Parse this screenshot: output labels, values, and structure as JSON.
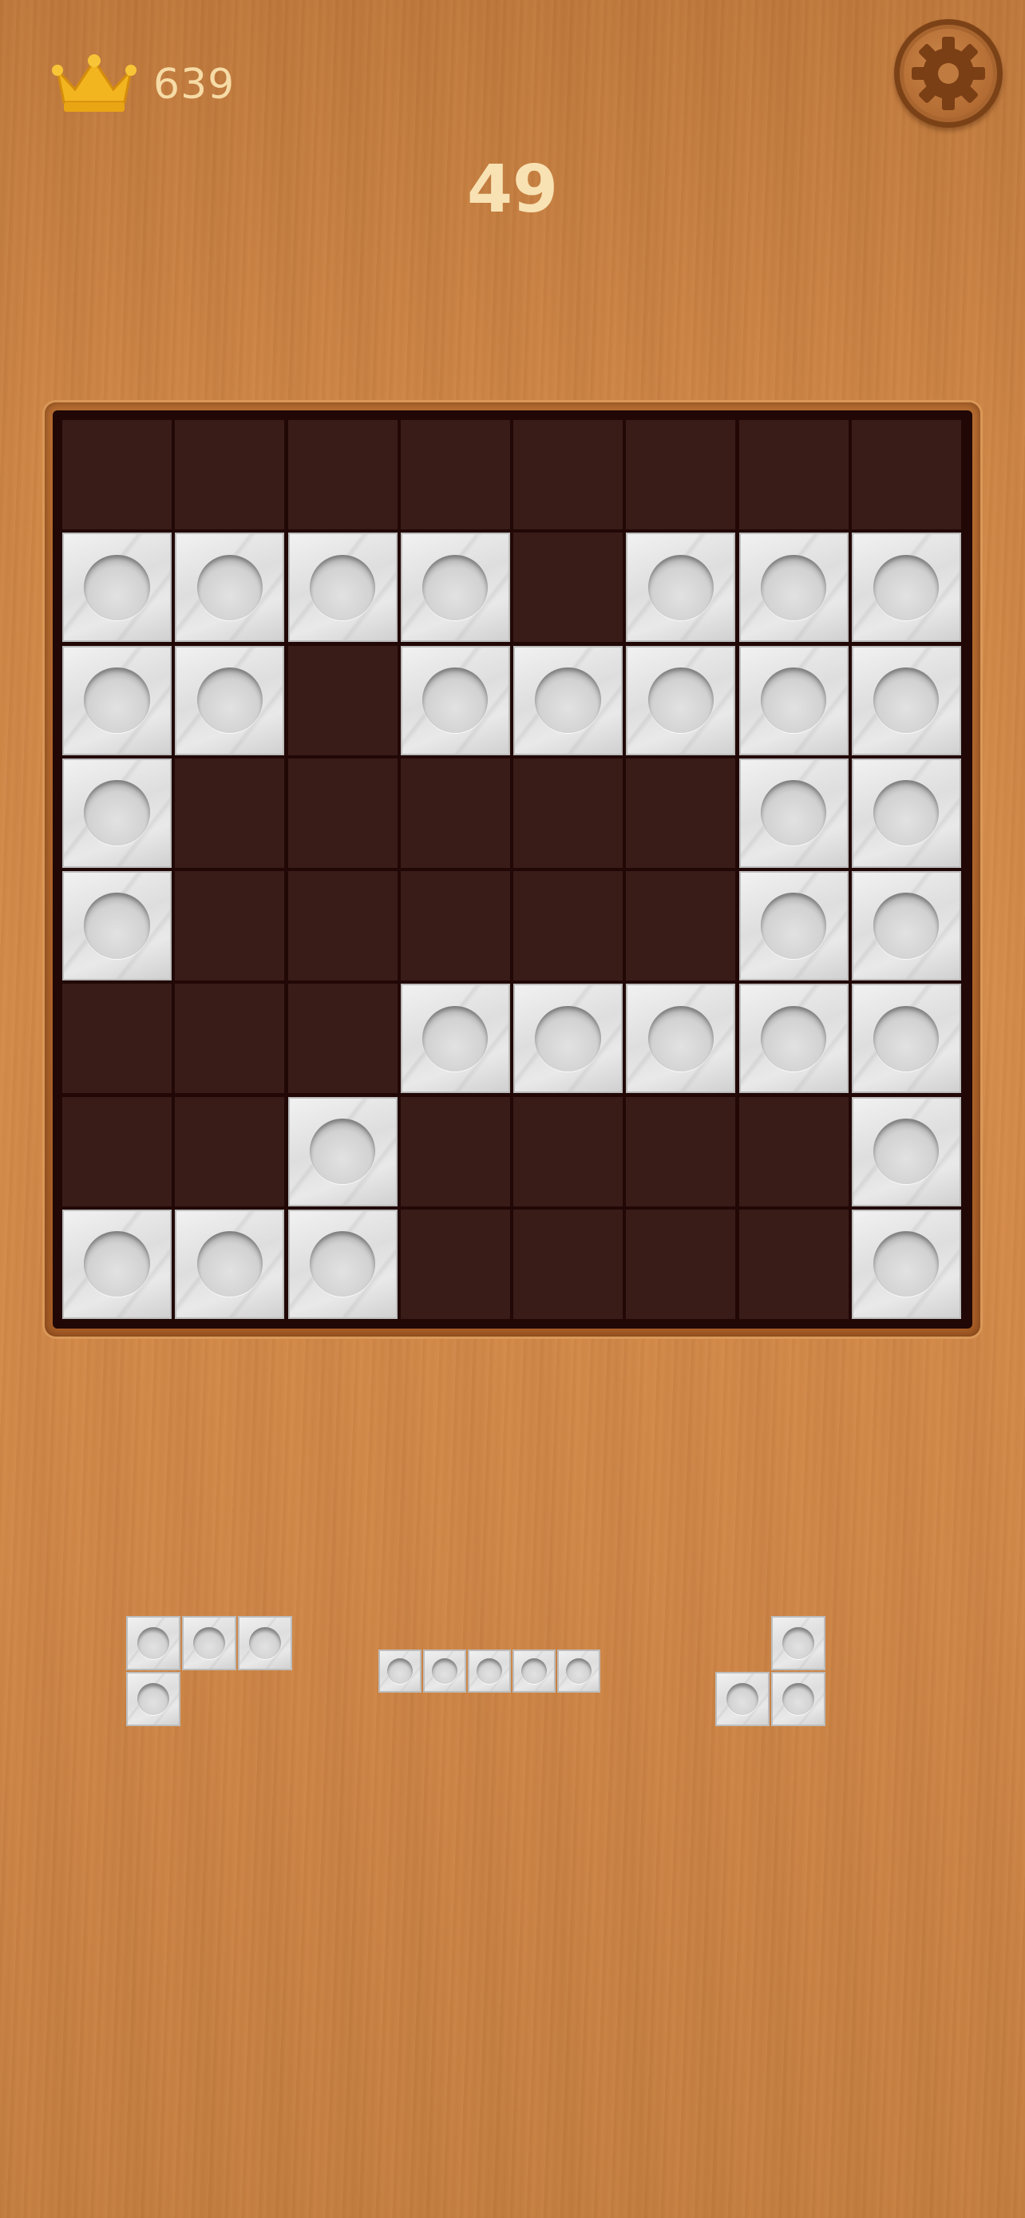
{
  "header": {
    "best_score": "639",
    "current_score": "49",
    "best_icon": "crown-icon",
    "settings_icon": "gear-icon"
  },
  "colors": {
    "wood": "#d18849",
    "score_text": "#f8e2b3",
    "board_empty": "#391c18",
    "board_grid": "#210806",
    "tile": "#e4e4e4",
    "crown": "#f2b520"
  },
  "board": {
    "rows": 8,
    "cols": 8,
    "cells": [
      [
        0,
        0,
        0,
        0,
        0,
        0,
        0,
        0
      ],
      [
        1,
        1,
        1,
        1,
        0,
        1,
        1,
        1
      ],
      [
        1,
        1,
        0,
        1,
        1,
        1,
        1,
        1
      ],
      [
        1,
        0,
        0,
        0,
        0,
        0,
        1,
        1
      ],
      [
        1,
        0,
        0,
        0,
        0,
        0,
        1,
        1
      ],
      [
        0,
        0,
        0,
        1,
        1,
        1,
        1,
        1
      ],
      [
        0,
        0,
        1,
        0,
        0,
        0,
        0,
        1
      ],
      [
        1,
        1,
        1,
        0,
        0,
        0,
        0,
        1
      ]
    ]
  },
  "tray": {
    "pieces": [
      {
        "id": "piece-1",
        "shape": [
          [
            1,
            1,
            1
          ],
          [
            1,
            0,
            0
          ]
        ]
      },
      {
        "id": "piece-2",
        "shape": [
          [
            1,
            1,
            1,
            1,
            1
          ]
        ]
      },
      {
        "id": "piece-3",
        "shape": [
          [
            0,
            1
          ],
          [
            1,
            1
          ]
        ]
      }
    ]
  }
}
